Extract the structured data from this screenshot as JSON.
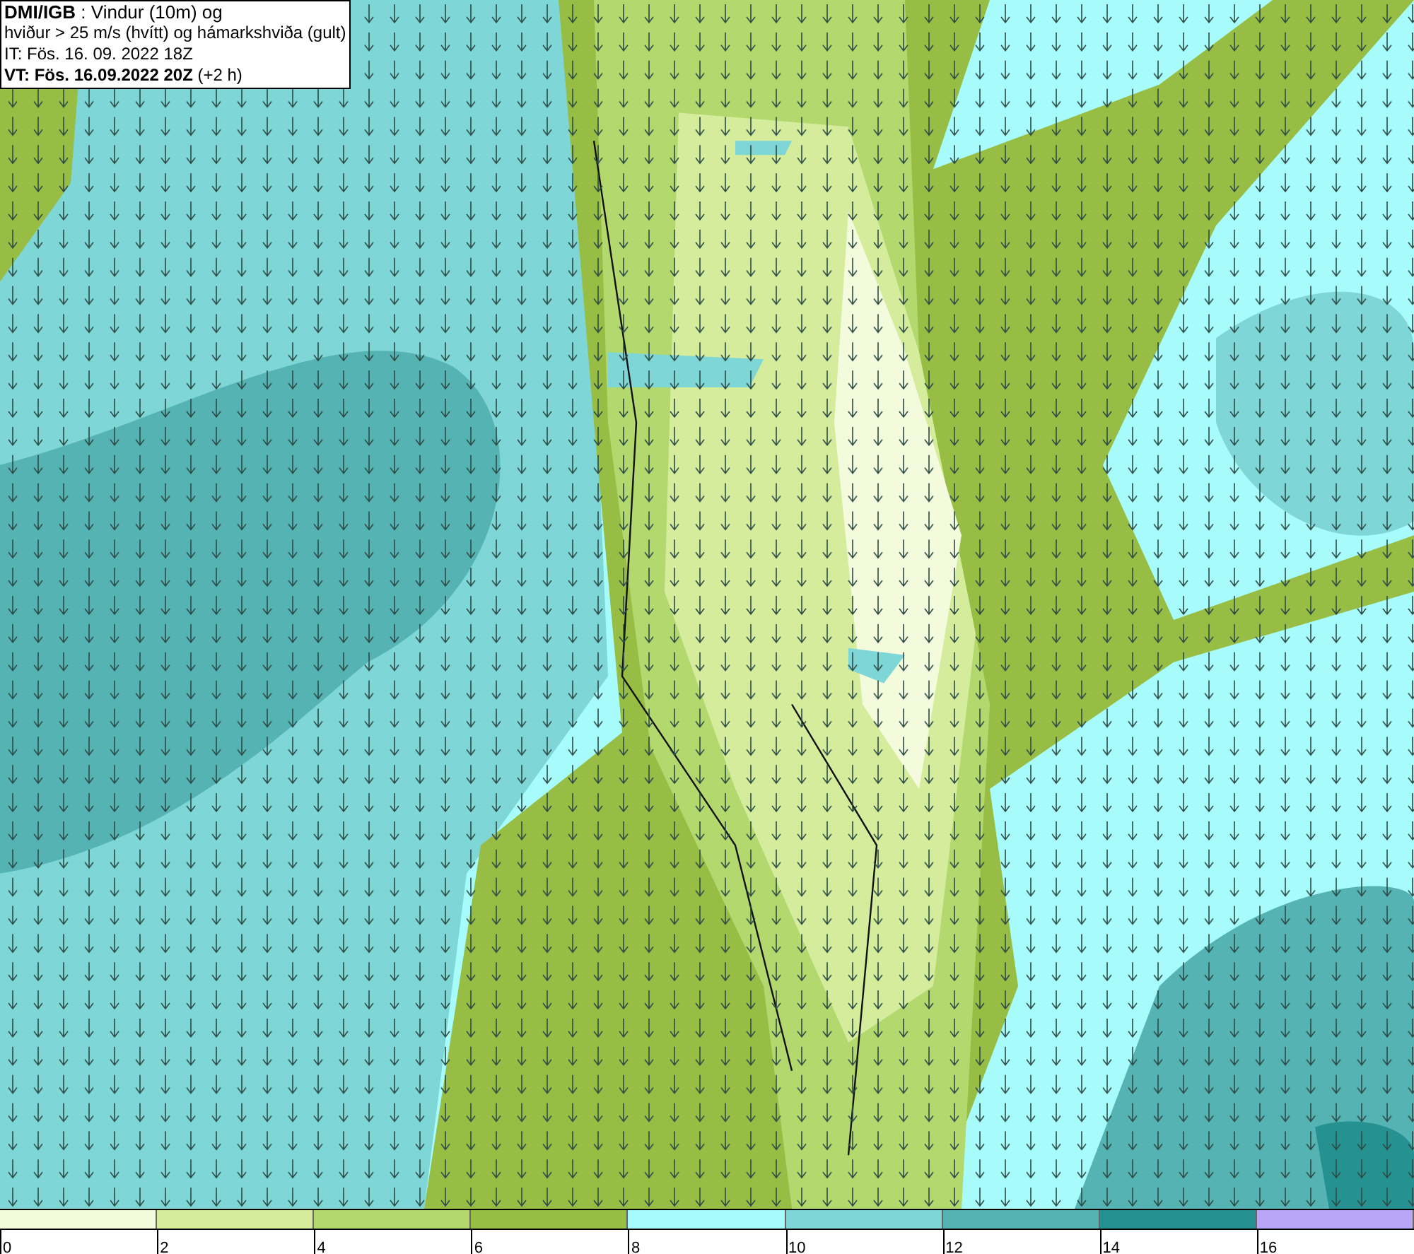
{
  "header": {
    "lines": [
      "**DMI/IGB** : Vindur (10m) og",
      "hviður > 25 m/s (hvítt) og hámarkshviða (gult)",
      "IT: Fös. 16. 09. 2022 18Z",
      "**VT: Fös. 16.09.2022 20Z** (+2 h)"
    ]
  },
  "legend": [
    {
      "color": "#f4fbdc",
      "label": "0"
    },
    {
      "color": "#d4ec9c",
      "label": "2"
    },
    {
      "color": "#b3d86e",
      "label": "4"
    },
    {
      "color": "#97bd45",
      "label": "6"
    },
    {
      "color": "#a8fbfb",
      "label": "8"
    },
    {
      "color": "#7fd6d6",
      "label": "10"
    },
    {
      "color": "#56b3b3",
      "label": "12"
    },
    {
      "color": "#259191",
      "label": "14"
    },
    {
      "color": "#b9a5f5",
      "label": "16"
    }
  ]
}
